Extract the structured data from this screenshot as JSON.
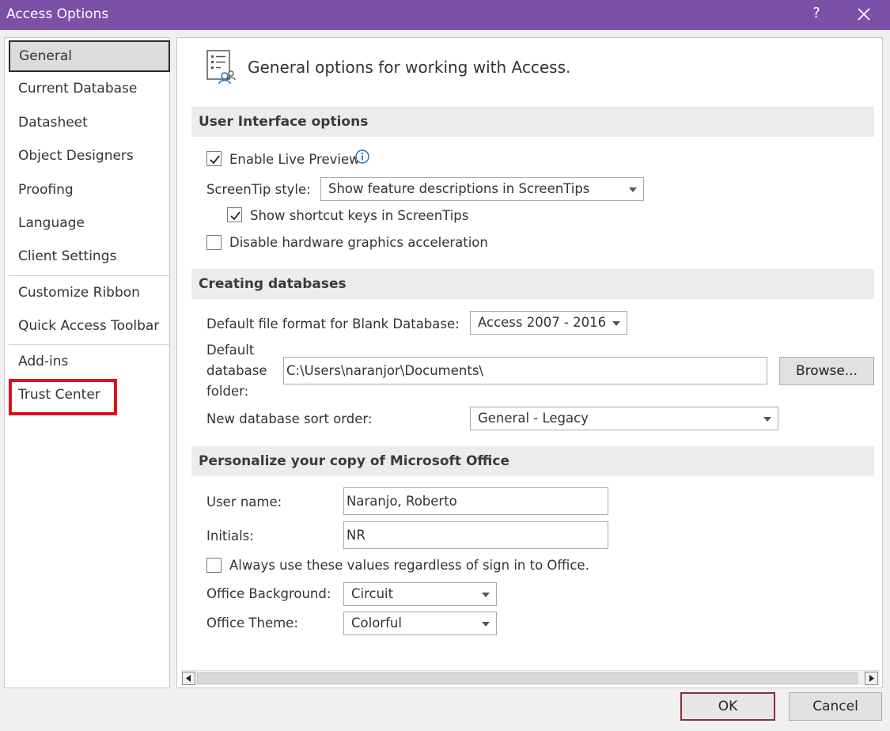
{
  "window": {
    "title": "Access Options",
    "help_label": "?"
  },
  "sidebar": {
    "items": [
      {
        "label": "General",
        "selected": true
      },
      {
        "label": "Current Database"
      },
      {
        "label": "Datasheet"
      },
      {
        "label": "Object Designers"
      },
      {
        "label": "Proofing"
      },
      {
        "label": "Language"
      },
      {
        "label": "Client Settings"
      },
      {
        "label": "Customize Ribbon"
      },
      {
        "label": "Quick Access Toolbar"
      },
      {
        "label": "Add-ins"
      },
      {
        "label": "Trust Center",
        "highlighted": true
      }
    ],
    "highlight_color": "#e0101b"
  },
  "main": {
    "header": "General options for working with Access.",
    "ui_options": {
      "section_title": "User Interface options",
      "live_preview": {
        "label": "Enable Live Preview",
        "checked": true
      },
      "screentip_label": "ScreenTip style:",
      "screentip_value": "Show feature descriptions in ScreenTips",
      "shortcut_keys": {
        "label": "Show shortcut keys in ScreenTips",
        "checked": true
      },
      "hw_accel": {
        "label": "Disable hardware graphics acceleration",
        "checked": false
      }
    },
    "creating_db": {
      "section_title": "Creating databases",
      "file_format_label": "Default file format for Blank Database:",
      "file_format_value": "Access 2007 - 2016",
      "folder_label_1": "Default",
      "folder_label_2": "database",
      "folder_label_3": "folder:",
      "folder_value": "C:\\Users\\naranjor\\Documents\\",
      "browse_label": "Browse...",
      "sort_order_label": "New database sort order:",
      "sort_order_value": "General - Legacy"
    },
    "personalize": {
      "section_title": "Personalize your copy of Microsoft Office",
      "user_name_label": "User name:",
      "user_name_value": "Naranjo, Roberto",
      "initials_label": "Initials:",
      "initials_value": "NR",
      "always_use": {
        "label": "Always use these values regardless of sign in to Office.",
        "checked": false
      },
      "background_label": "Office Background:",
      "background_value": "Circuit",
      "theme_label": "Office Theme:",
      "theme_value": "Colorful"
    }
  },
  "footer": {
    "ok_label": "OK",
    "cancel_label": "Cancel"
  },
  "colors": {
    "titlebar": "#7b51a8",
    "ok_border": "#8a2d35"
  }
}
